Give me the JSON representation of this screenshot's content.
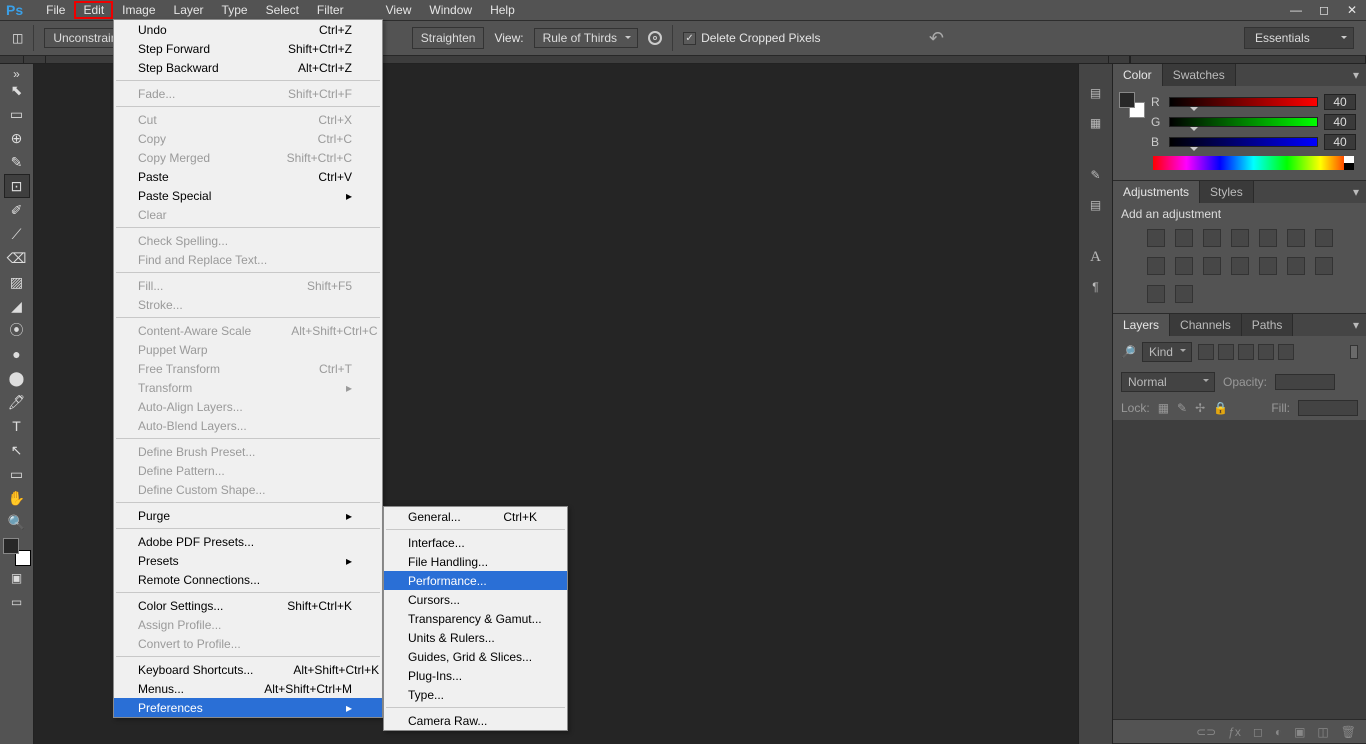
{
  "menubar": [
    "File",
    "Edit",
    "Image",
    "Layer",
    "Type",
    "Select",
    "Filter",
    "View",
    "Window",
    "Help"
  ],
  "menubar_active": 1,
  "optbar": {
    "unconstrained": "Unconstrained",
    "straighten": "Straighten",
    "view": "View:",
    "view_val": "Rule of Thirds",
    "delete": "Delete Cropped Pixels",
    "essentials": "Essentials"
  },
  "edit_menu": [
    {
      "label": "Undo",
      "sc": "Ctrl+Z"
    },
    {
      "label": "Step Forward",
      "sc": "Shift+Ctrl+Z"
    },
    {
      "label": "Step Backward",
      "sc": "Alt+Ctrl+Z"
    },
    {
      "sep": true
    },
    {
      "label": "Fade...",
      "sc": "Shift+Ctrl+F",
      "disabled": true
    },
    {
      "sep": true
    },
    {
      "label": "Cut",
      "sc": "Ctrl+X",
      "disabled": true
    },
    {
      "label": "Copy",
      "sc": "Ctrl+C",
      "disabled": true
    },
    {
      "label": "Copy Merged",
      "sc": "Shift+Ctrl+C",
      "disabled": true
    },
    {
      "label": "Paste",
      "sc": "Ctrl+V"
    },
    {
      "label": "Paste Special",
      "sub": true
    },
    {
      "label": "Clear",
      "disabled": true
    },
    {
      "sep": true
    },
    {
      "label": "Check Spelling...",
      "disabled": true
    },
    {
      "label": "Find and Replace Text...",
      "disabled": true
    },
    {
      "sep": true
    },
    {
      "label": "Fill...",
      "sc": "Shift+F5",
      "disabled": true
    },
    {
      "label": "Stroke...",
      "disabled": true
    },
    {
      "sep": true
    },
    {
      "label": "Content-Aware Scale",
      "sc": "Alt+Shift+Ctrl+C",
      "disabled": true
    },
    {
      "label": "Puppet Warp",
      "disabled": true
    },
    {
      "label": "Free Transform",
      "sc": "Ctrl+T",
      "disabled": true
    },
    {
      "label": "Transform",
      "sub": true,
      "disabled": true
    },
    {
      "label": "Auto-Align Layers...",
      "disabled": true
    },
    {
      "label": "Auto-Blend Layers...",
      "disabled": true
    },
    {
      "sep": true
    },
    {
      "label": "Define Brush Preset...",
      "disabled": true
    },
    {
      "label": "Define Pattern...",
      "disabled": true
    },
    {
      "label": "Define Custom Shape...",
      "disabled": true
    },
    {
      "sep": true
    },
    {
      "label": "Purge",
      "sub": true
    },
    {
      "sep": true
    },
    {
      "label": "Adobe PDF Presets..."
    },
    {
      "label": "Presets",
      "sub": true
    },
    {
      "label": "Remote Connections..."
    },
    {
      "sep": true
    },
    {
      "label": "Color Settings...",
      "sc": "Shift+Ctrl+K"
    },
    {
      "label": "Assign Profile...",
      "disabled": true
    },
    {
      "label": "Convert to Profile...",
      "disabled": true
    },
    {
      "sep": true
    },
    {
      "label": "Keyboard Shortcuts...",
      "sc": "Alt+Shift+Ctrl+K"
    },
    {
      "label": "Menus...",
      "sc": "Alt+Shift+Ctrl+M"
    },
    {
      "label": "Preferences",
      "sub": true,
      "hl": true
    }
  ],
  "prefs_menu": [
    {
      "label": "General...",
      "sc": "Ctrl+K"
    },
    {
      "sep": true
    },
    {
      "label": "Interface..."
    },
    {
      "label": "File Handling..."
    },
    {
      "label": "Performance...",
      "hl": true
    },
    {
      "label": "Cursors..."
    },
    {
      "label": "Transparency & Gamut..."
    },
    {
      "label": "Units & Rulers..."
    },
    {
      "label": "Guides, Grid & Slices..."
    },
    {
      "label": "Plug-Ins..."
    },
    {
      "label": "Type..."
    },
    {
      "sep": true
    },
    {
      "label": "Camera Raw..."
    }
  ],
  "panels": {
    "color": {
      "tab1": "Color",
      "tab2": "Swatches",
      "R": "R",
      "G": "G",
      "B": "B",
      "val": "40"
    },
    "adjust": {
      "tab1": "Adjustments",
      "tab2": "Styles",
      "heading": "Add an adjustment"
    },
    "layers": {
      "tab1": "Layers",
      "tab2": "Channels",
      "tab3": "Paths",
      "kind": "Kind",
      "normal": "Normal",
      "opacity": "Opacity:",
      "lock": "Lock:",
      "fill": "Fill:"
    }
  },
  "tools": [
    "⬉",
    "▭",
    "⊕",
    "✎",
    "⊡",
    "✐",
    "⟋",
    "⌫",
    "▨",
    "◢",
    "⦿",
    "●",
    "⬤",
    "🖊",
    "T",
    "↖",
    "▭",
    "✋",
    "🔍"
  ]
}
